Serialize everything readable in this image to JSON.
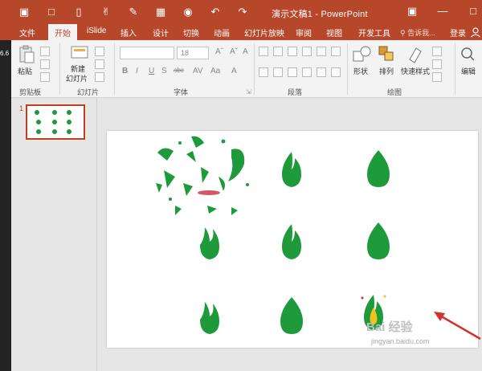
{
  "titlebar": {
    "title": "演示文稿1 - PowerPoint",
    "qat": [
      "save-icon",
      "open-folder-icon",
      "new-file-icon",
      "pointer-icon",
      "pen-icon",
      "preview-icon",
      "camera-icon",
      "undo-icon",
      "redo-icon"
    ],
    "window_controls": [
      "ribbon-display-icon",
      "minimize-icon",
      "restore-icon"
    ]
  },
  "tabs": [
    {
      "label": "文件",
      "active": false
    },
    {
      "label": "开始",
      "active": true
    },
    {
      "label": "iSlide",
      "active": false
    },
    {
      "label": "插入",
      "active": false
    },
    {
      "label": "设计",
      "active": false
    },
    {
      "label": "切换",
      "active": false
    },
    {
      "label": "动画",
      "active": false
    },
    {
      "label": "幻灯片放映",
      "active": false
    },
    {
      "label": "审阅",
      "active": false
    },
    {
      "label": "视图",
      "active": false
    },
    {
      "label": "开发工具",
      "active": false
    }
  ],
  "tellme": "告诉我...",
  "login": "登录",
  "ribbon": {
    "clipboard": {
      "paste": "粘贴",
      "group": "剪贴板"
    },
    "slides": {
      "new_slide_line1": "新建",
      "new_slide_line2": "幻灯片",
      "group": "幻灯片"
    },
    "font": {
      "size": "18",
      "group": "字体",
      "bold": "B",
      "italic": "I",
      "underline": "U",
      "strike": "S",
      "shadow": "abc"
    },
    "paragraph": {
      "group": "段落"
    },
    "drawing": {
      "shapes": "形状",
      "arrange": "排列",
      "quick_styles": "快速样式",
      "group": "绘图"
    },
    "editing": {
      "label": "编辑"
    }
  },
  "left_strip": {
    "value": "6.6"
  },
  "slides_pane": {
    "slide_number": "1"
  },
  "watermark": {
    "brand": "Bai 经验",
    "url": "jingyan.baidu.com"
  },
  "colors": {
    "accent": "#b7472a",
    "flame": "#1e9a3a",
    "shadow": "#cc2a3a"
  }
}
